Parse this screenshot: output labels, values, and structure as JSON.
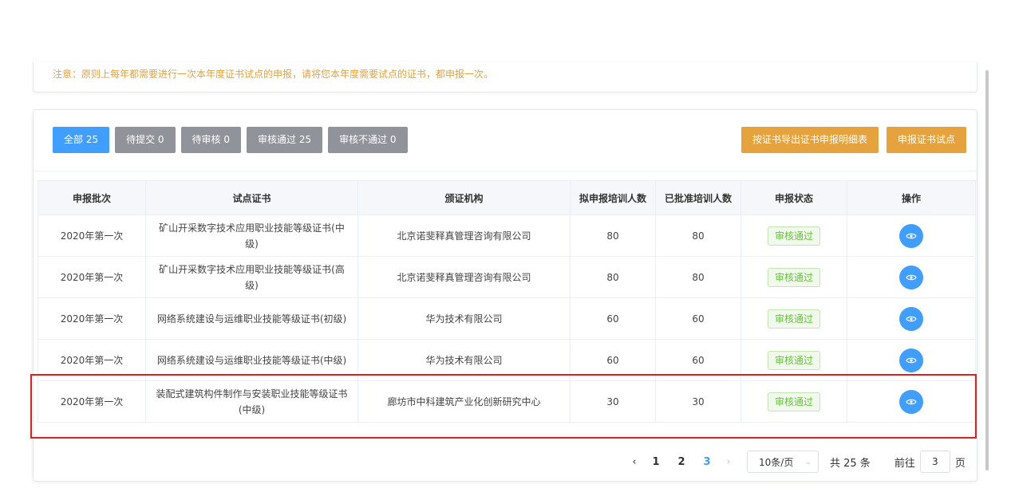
{
  "notice": "注意：原则上每年都需要进行一次本年度证书试点的申报，请将您本年度需要试点的证书，都申报一次。",
  "tabs": [
    {
      "label": "全部 25",
      "active": true
    },
    {
      "label": "待提交 0",
      "active": false
    },
    {
      "label": "待审核 0",
      "active": false
    },
    {
      "label": "审核通过 25",
      "active": false
    },
    {
      "label": "审核不通过 0",
      "active": false
    }
  ],
  "actions": {
    "export_label": "按证书导出证书申报明细表",
    "apply_label": "申报证书试点"
  },
  "table": {
    "headers": [
      "申报批次",
      "试点证书",
      "颁证机构",
      "拟申报培训人数",
      "已批准培训人数",
      "申报状态",
      "操作"
    ],
    "rows": [
      {
        "batch": "2020年第一次",
        "cert": "矿山开采数字技术应用职业技能等级证书(中级)",
        "org": "北京诺斐释真管理咨询有限公司",
        "planned": "80",
        "approved": "80",
        "status": "审核通过"
      },
      {
        "batch": "2020年第一次",
        "cert": "矿山开采数字技术应用职业技能等级证书(高级)",
        "org": "北京诺斐释真管理咨询有限公司",
        "planned": "80",
        "approved": "80",
        "status": "审核通过"
      },
      {
        "batch": "2020年第一次",
        "cert": "网络系统建设与运维职业技能等级证书(初级)",
        "org": "华为技术有限公司",
        "planned": "60",
        "approved": "60",
        "status": "审核通过"
      },
      {
        "batch": "2020年第一次",
        "cert": "网络系统建设与运维职业技能等级证书(中级)",
        "org": "华为技术有限公司",
        "planned": "60",
        "approved": "60",
        "status": "审核通过"
      },
      {
        "batch": "2020年第一次",
        "cert": "装配式建筑构件制作与安装职业技能等级证书(中级)",
        "org": "廊坊市中科建筑产业化创新研究中心",
        "planned": "30",
        "approved": "30",
        "status": "审核通过"
      }
    ]
  },
  "pagination": {
    "prev": "‹",
    "pages": [
      "1",
      "2",
      "3"
    ],
    "current_page": "3",
    "next": "›",
    "page_size": "10条/页",
    "total": "共 25 条",
    "goto_prefix": "前往",
    "goto_value": "3",
    "goto_suffix": "页"
  },
  "colors": {
    "primary": "#409eff",
    "warning": "#e6a23c",
    "info": "#909399",
    "success": "#67c23a",
    "highlight": "#e02020"
  },
  "icons": {
    "view": "eye-icon",
    "select": "chevron-down-icon"
  }
}
